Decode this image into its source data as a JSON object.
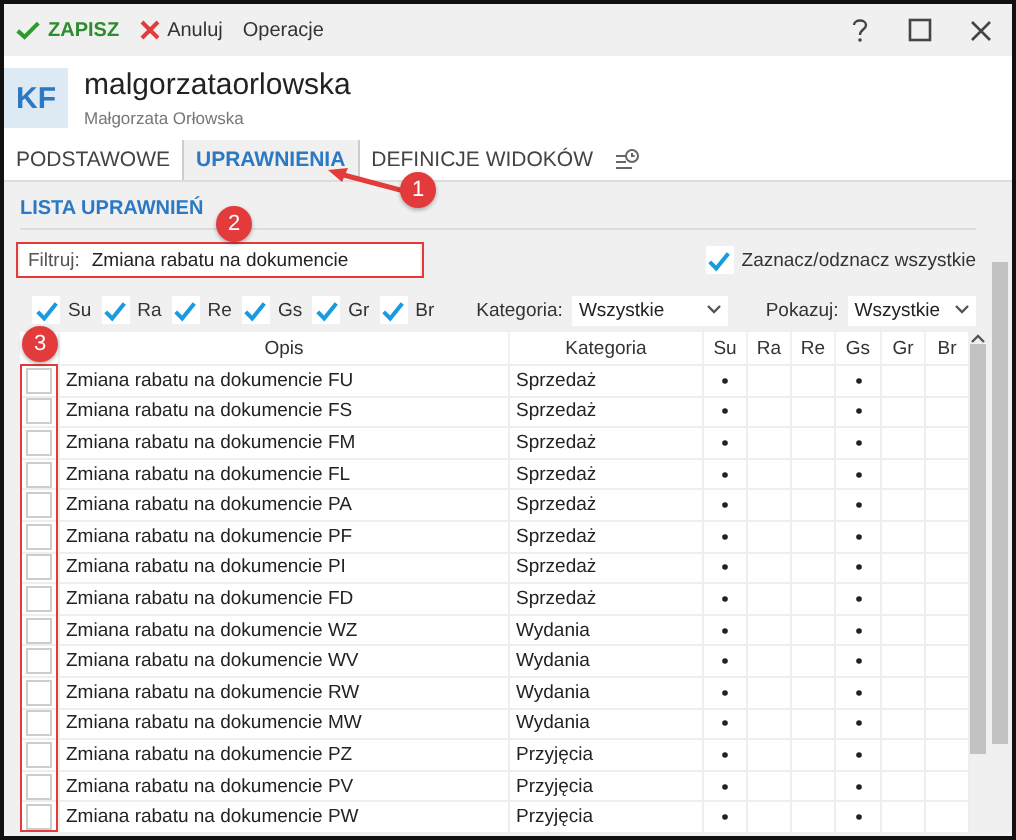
{
  "toolbar": {
    "save": "ZAPISZ",
    "cancel": "Anuluj",
    "operations": "Operacje"
  },
  "header": {
    "initials": "KF",
    "login": "malgorzataorlowska",
    "full_name": "Małgorzata Orłowska"
  },
  "tabs": {
    "annotation": "1",
    "items": [
      {
        "label": "PODSTAWOWE",
        "selected": false
      },
      {
        "label": "UPRAWNIENIA",
        "selected": true
      },
      {
        "label": "DEFINICJE WIDOKÓW",
        "selected": false
      }
    ]
  },
  "section_title": "LISTA UPRAWNIEŃ",
  "filter": {
    "annotation": "2",
    "label": "Filtruj:",
    "value": "Zmiana rabatu na dokumencie"
  },
  "select_all": {
    "label": "Zaznacz/odznacz wszystkie",
    "checked": true
  },
  "flags": [
    {
      "label": "Su",
      "checked": true
    },
    {
      "label": "Ra",
      "checked": true
    },
    {
      "label": "Re",
      "checked": true
    },
    {
      "label": "Gs",
      "checked": true
    },
    {
      "label": "Gr",
      "checked": true
    },
    {
      "label": "Br",
      "checked": true
    }
  ],
  "category_filter": {
    "label": "Kategoria:",
    "value": "Wszystkie"
  },
  "show_filter": {
    "label": "Pokazuj:",
    "value": "Wszystkie"
  },
  "table": {
    "annotation": "3",
    "columns": [
      "Opis",
      "Kategoria",
      "Su",
      "Ra",
      "Re",
      "Gs",
      "Gr",
      "Br"
    ],
    "rows": [
      {
        "checked": false,
        "opis": "Zmiana rabatu na dokumencie FU",
        "kategoria": "Sprzedaż",
        "dots": [
          true,
          false,
          false,
          true,
          false,
          false
        ]
      },
      {
        "checked": false,
        "opis": "Zmiana rabatu na dokumencie FS",
        "kategoria": "Sprzedaż",
        "dots": [
          true,
          false,
          false,
          true,
          false,
          false
        ]
      },
      {
        "checked": false,
        "opis": "Zmiana rabatu na dokumencie FM",
        "kategoria": "Sprzedaż",
        "dots": [
          true,
          false,
          false,
          true,
          false,
          false
        ]
      },
      {
        "checked": false,
        "opis": "Zmiana rabatu na dokumencie FL",
        "kategoria": "Sprzedaż",
        "dots": [
          true,
          false,
          false,
          true,
          false,
          false
        ]
      },
      {
        "checked": false,
        "opis": "Zmiana rabatu na dokumencie PA",
        "kategoria": "Sprzedaż",
        "dots": [
          true,
          false,
          false,
          true,
          false,
          false
        ]
      },
      {
        "checked": false,
        "opis": "Zmiana rabatu na dokumencie PF",
        "kategoria": "Sprzedaż",
        "dots": [
          true,
          false,
          false,
          true,
          false,
          false
        ]
      },
      {
        "checked": false,
        "opis": "Zmiana rabatu na dokumencie PI",
        "kategoria": "Sprzedaż",
        "dots": [
          true,
          false,
          false,
          true,
          false,
          false
        ]
      },
      {
        "checked": false,
        "opis": "Zmiana rabatu na dokumencie FD",
        "kategoria": "Sprzedaż",
        "dots": [
          true,
          false,
          false,
          true,
          false,
          false
        ]
      },
      {
        "checked": false,
        "opis": "Zmiana rabatu na dokumencie WZ",
        "kategoria": "Wydania",
        "dots": [
          true,
          false,
          false,
          true,
          false,
          false
        ]
      },
      {
        "checked": false,
        "opis": "Zmiana rabatu na dokumencie WV",
        "kategoria": "Wydania",
        "dots": [
          true,
          false,
          false,
          true,
          false,
          false
        ]
      },
      {
        "checked": false,
        "opis": "Zmiana rabatu na dokumencie RW",
        "kategoria": "Wydania",
        "dots": [
          true,
          false,
          false,
          true,
          false,
          false
        ]
      },
      {
        "checked": false,
        "opis": "Zmiana rabatu na dokumencie MW",
        "kategoria": "Wydania",
        "dots": [
          true,
          false,
          false,
          true,
          false,
          false
        ]
      },
      {
        "checked": false,
        "opis": "Zmiana rabatu na dokumencie PZ",
        "kategoria": "Przyjęcia",
        "dots": [
          true,
          false,
          false,
          true,
          false,
          false
        ]
      },
      {
        "checked": false,
        "opis": "Zmiana rabatu na dokumencie PV",
        "kategoria": "Przyjęcia",
        "dots": [
          true,
          false,
          false,
          true,
          false,
          false
        ]
      },
      {
        "checked": false,
        "opis": "Zmiana rabatu na dokumencie PW",
        "kategoria": "Przyjęcia",
        "dots": [
          true,
          false,
          false,
          true,
          false,
          false
        ]
      }
    ]
  }
}
